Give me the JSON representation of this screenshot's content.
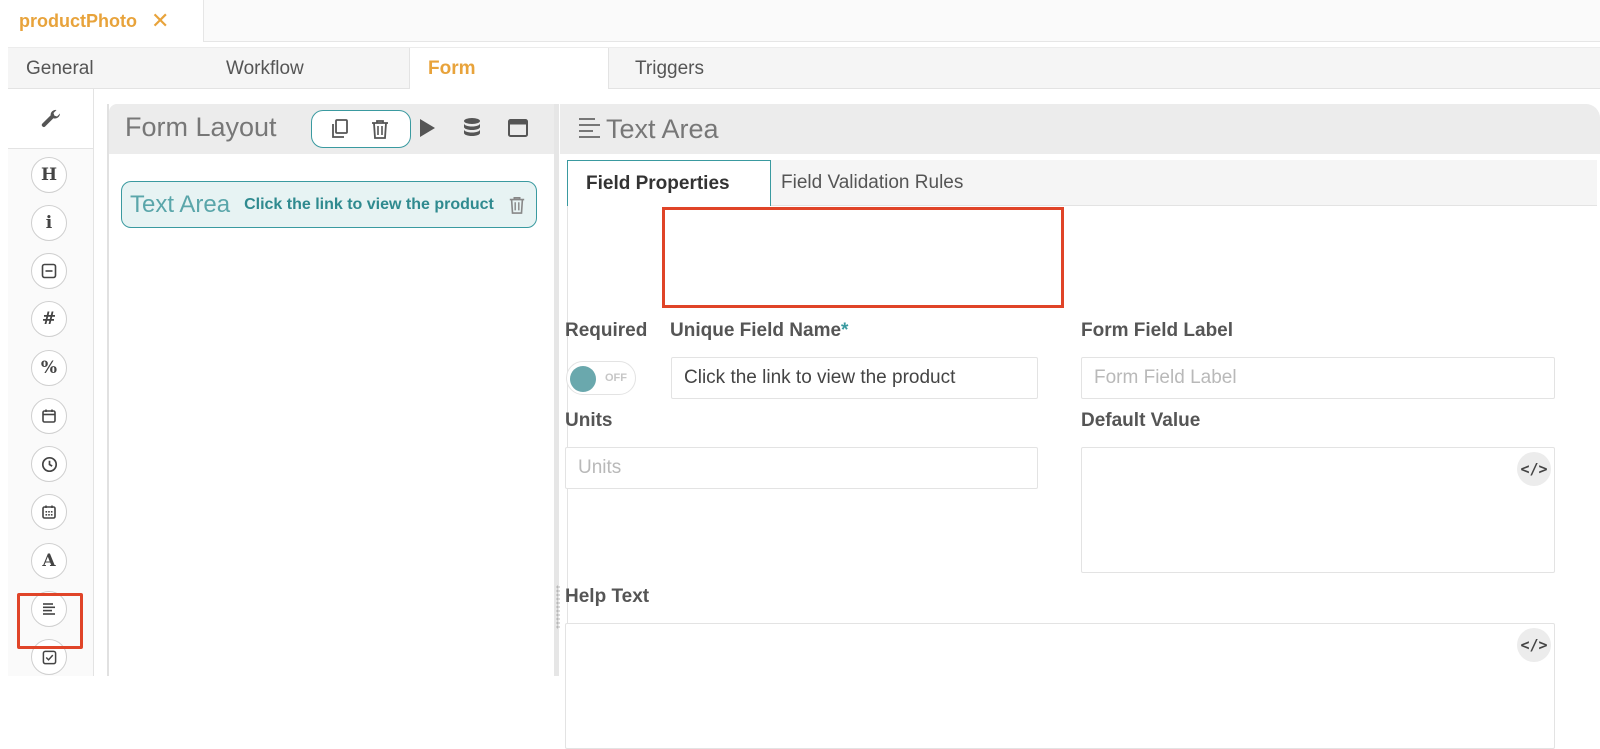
{
  "document_tab": {
    "title": "productPhoto",
    "close_glyph": "✕"
  },
  "section_tabs": [
    {
      "label": "General",
      "active": false
    },
    {
      "label": "Workflow",
      "active": false
    },
    {
      "label": "Form",
      "active": true
    },
    {
      "label": "Triggers",
      "active": false
    }
  ],
  "toolbar": {
    "settings_icon": "wrench-icon",
    "tools": [
      {
        "name": "heading-tool",
        "glyph": "H"
      },
      {
        "name": "info-tool",
        "glyph": "i"
      },
      {
        "name": "separator-tool",
        "glyph": "⊟"
      },
      {
        "name": "number-tool",
        "glyph": "#"
      },
      {
        "name": "percent-tool",
        "glyph": "%"
      },
      {
        "name": "date-tool",
        "glyph": "📅"
      },
      {
        "name": "time-tool",
        "glyph": "🕘"
      },
      {
        "name": "datetime-tool",
        "glyph": "📆"
      },
      {
        "name": "text-tool",
        "glyph": "A"
      },
      {
        "name": "text-area-tool",
        "glyph": "≡"
      },
      {
        "name": "checkbox-tool",
        "glyph": "☑"
      }
    ],
    "highlighted_tool": "text-area-tool"
  },
  "form_layout": {
    "title": "Form Layout",
    "field": {
      "type": "Text Area",
      "name": "Click the link to view the product"
    }
  },
  "properties": {
    "title": "Text Area",
    "tabs": [
      {
        "label": "Field Properties",
        "active": true
      },
      {
        "label": "Field Validation Rules",
        "active": false
      }
    ],
    "required_label": "Required",
    "required_toggle": "OFF",
    "unique_name_label": "Unique Field Name",
    "required_marker": "*",
    "unique_name_value": "Click the link to view the product",
    "form_label_label": "Form Field Label",
    "form_label_placeholder": "Form Field Label",
    "units_label": "Units",
    "units_placeholder": "Units",
    "default_value_label": "Default Value",
    "help_text_label": "Help Text",
    "code_glyph": "</>"
  },
  "colors": {
    "accent": "#e8a33b",
    "teal": "#3a9aa0",
    "highlight": "#e04428"
  }
}
